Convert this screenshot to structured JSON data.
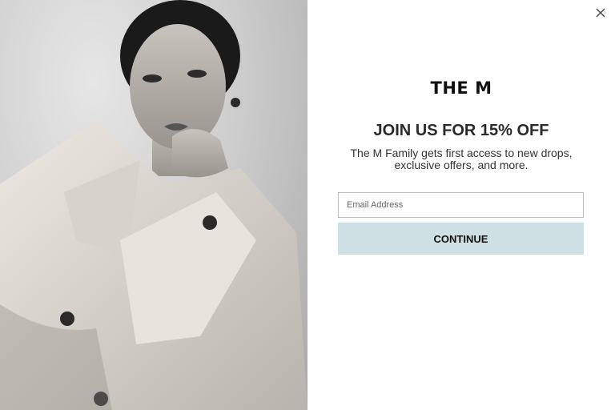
{
  "brand": {
    "logo_text": "THE M"
  },
  "offer": {
    "headline": "JOIN US FOR 15% OFF",
    "subtext": "The M Family gets first access to new drops, exclusive offers, and more."
  },
  "form": {
    "email_placeholder": "Email Address",
    "email_value": "",
    "submit_label": "CONTINUE"
  },
  "colors": {
    "button_bg": "#cfe0e5",
    "text_dark": "#2a2a2a"
  },
  "icons": {
    "close": "close-icon"
  }
}
